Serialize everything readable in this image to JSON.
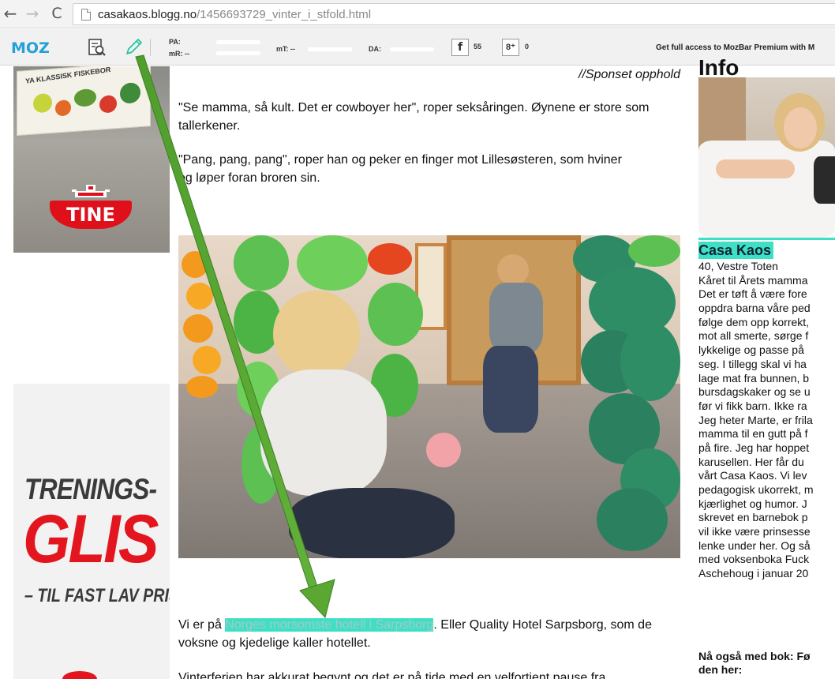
{
  "browser": {
    "url_host": "casakaos.blogg.no",
    "url_path": "/1456693729_vinter_i_stfold.html",
    "back_glyph": "←",
    "forward_glyph": "→",
    "reload_glyph": "C"
  },
  "mozbar": {
    "logo": "MOZ",
    "pa_label": "PA:",
    "mr_label": "mR: --",
    "mt_label": "mT: --",
    "da_label": "DA:",
    "facebook_glyph": "f",
    "facebook_count": "55",
    "gplus_glyph": "8⁺",
    "gplus_count": "0",
    "premium_text": "Get full access to MozBar Premium with M"
  },
  "ads": {
    "top": {
      "carton_text": "YA KLASSISK FISKEBOR",
      "brand": "TINE"
    },
    "bottom": {
      "line1": "TRENINGS-",
      "line2": "GLIS",
      "line3": "– TIL FAST LAV PRIS"
    }
  },
  "article": {
    "sponsored": "//Sponset opphold",
    "p1": "\"Se mamma, så kult. Det er cowboyer her\", roper seksåringen. Øynene er store som tallerkener.",
    "p2_a": "\"Pang, pang, pang\", roper han og peker en finger mot Lillesøsteren, som hviner",
    "p2_b": "og løper foran broren sin.",
    "p3_before": "Vi er på ",
    "p3_link": "Norges morsomste hotell i Sarpsborg",
    "p3_after": ". Eller Quality Hotel Sarpsborg, som de voksne og kjedelige kaller hotellet.",
    "p4": "Vinterferien har akkurat begynt og det er på tide med en velfortjent pause fra"
  },
  "sidebar": {
    "heading": "Info",
    "name": "Casa Kaos",
    "lines": [
      "40, Vestre Toten",
      "Kåret til Årets mamma",
      "Det er tøft å være fore",
      "oppdra barna våre ped",
      "følge dem opp korrekt,",
      "mot all smerte, sørge f",
      "lykkelige og passe på",
      "seg. I tillegg skal vi ha",
      "lage mat fra bunnen, b",
      "bursdagskaker og se u",
      "før vi fikk barn. Ikke ra",
      "Jeg heter Marte, er frila",
      "mamma til en gutt på f",
      "på fire. Jeg har hoppet",
      "karusellen. Her får du",
      "vårt Casa Kaos. Vi lev",
      "pedagogisk ukorrekt, m",
      "kjærlighet og humor. J",
      "skrevet en barnebok p",
      "vil ikke være prinsesse",
      "lenke under her. Og så",
      "med voksenboka Fuck",
      "Aschehoug i januar 20"
    ],
    "book_line1": "Nå også med bok: Fø",
    "book_line2": "den her:"
  },
  "colors": {
    "highlight": "#3ee0c5",
    "arrow": "#5aa832",
    "moz_blue": "#22a0d8",
    "tine_red": "#e0101b"
  }
}
